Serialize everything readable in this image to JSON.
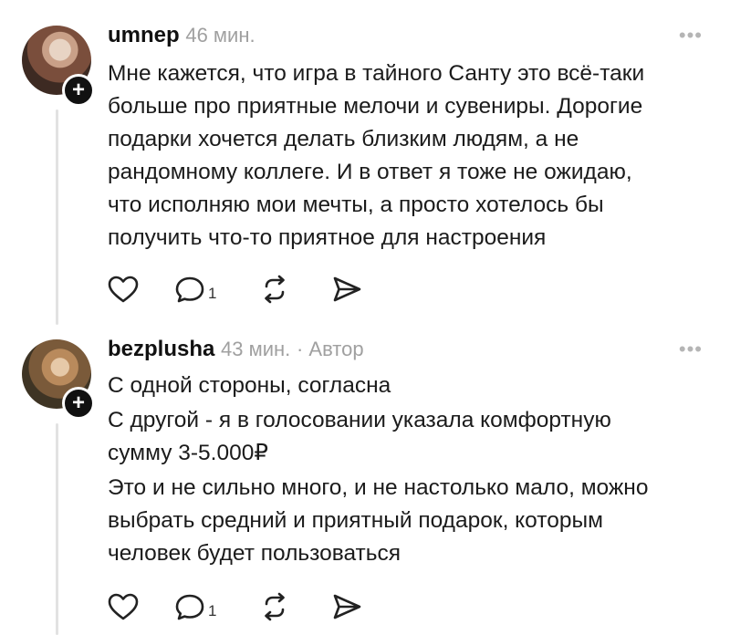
{
  "comments": [
    {
      "author": "umnep",
      "time": "46 мин.",
      "author_tag": "",
      "more_label": "•••",
      "avatar_icon": "user-avatar",
      "plus_label": "+",
      "lines": [
        "Мне кажется, что игра в тайного Санту это всё-таки",
        "больше про приятные мелочи и сувениры. Дорогие",
        "подарки хочется делать близким людям, а не",
        "рандомному коллеге. И в ответ я тоже не ожидаю,",
        "что исполняю мои мечты, а просто хотелось бы",
        "получить что-то приятное для настроения"
      ],
      "reply_count": "1"
    },
    {
      "author": "bezplusha",
      "time": "43 мин.",
      "author_tag": "· Автор",
      "more_label": "•••",
      "avatar_icon": "user-avatar",
      "plus_label": "+",
      "lines": [
        "С одной стороны, согласна",
        "С другой - я в голосовании указала комфортную",
        "сумму 3-5.000₽",
        "Это и не сильно много, и не настолько мало, можно",
        "выбрать средний и приятный подарок, которым",
        "человек будет пользоваться"
      ],
      "reply_count": "1"
    }
  ],
  "icons": [
    "heart-icon",
    "comment-icon",
    "repost-icon",
    "share-icon"
  ]
}
